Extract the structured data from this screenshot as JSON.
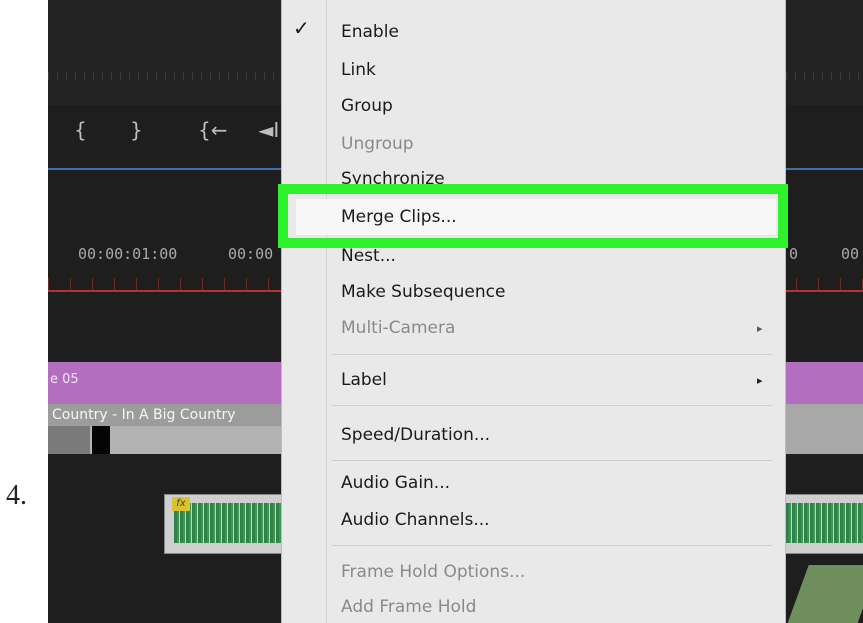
{
  "step_number": "4.",
  "timeline": {
    "timecodes": [
      "00:00:01:00",
      "00:00",
      "0",
      "00"
    ],
    "track_label_purple": "e 05",
    "clip_label": "Country - In A Big Country",
    "toolbar_glyphs": [
      "{",
      "}",
      "{←",
      "◄I"
    ],
    "fx_badge": "fx"
  },
  "context_menu": {
    "items": [
      {
        "label": "Enable",
        "checked": true,
        "disabled": false
      },
      {
        "label": "Link",
        "disabled": false
      },
      {
        "label": "Group",
        "disabled": false
      },
      {
        "label": "Ungroup",
        "disabled": true
      },
      {
        "label": "Synchronize",
        "disabled": false
      },
      {
        "label": "Merge Clips...",
        "disabled": false,
        "highlighted": true
      },
      {
        "label": "Nest...",
        "disabled": false
      },
      {
        "label": "Make Subsequence",
        "disabled": false
      },
      {
        "label": "Multi-Camera",
        "disabled": true,
        "submenu": true
      },
      {
        "label": "Label",
        "disabled": false,
        "submenu": true
      },
      {
        "label": "Speed/Duration...",
        "disabled": false
      },
      {
        "label": "Audio Gain...",
        "disabled": false
      },
      {
        "label": "Audio Channels...",
        "disabled": false
      },
      {
        "label": "Frame Hold Options...",
        "disabled": true
      },
      {
        "label": "Add Frame Hold",
        "disabled": true
      }
    ],
    "checkmark": "✓",
    "submenu_arrow": "▸"
  },
  "colors": {
    "highlight": "#2df22d",
    "purple_track": "#b46ec0",
    "timeline_bg": "#1e1e1e",
    "menu_bg": "#e9e9e9"
  }
}
